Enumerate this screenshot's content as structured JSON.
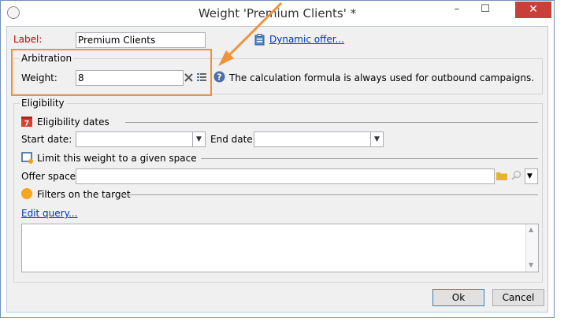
{
  "window": {
    "title": "Weight 'Premium Clients' *",
    "minimize": "–",
    "maximize": "☐",
    "close": "✕"
  },
  "label_field": {
    "label": "Label:",
    "value": "Premium Clients"
  },
  "dynamic_offer": {
    "link": "Dynamic offer..."
  },
  "arbitration": {
    "title": "Arbitration",
    "weight_label": "Weight:",
    "weight_value": "8",
    "info": "The calculation formula is always used for outbound campaigns."
  },
  "eligibility": {
    "title": "Eligibility",
    "dates_section": "Eligibility dates",
    "start_label": "Start date:",
    "end_label": "End date:",
    "limit_section": "Limit this weight to a given space",
    "offer_space_label": "Offer space:",
    "filters_section": "Filters on the target",
    "edit_query": "Edit query..."
  },
  "buttons": {
    "ok": "Ok",
    "cancel": "Cancel"
  },
  "colors": {
    "highlight": "#f0923b",
    "required_label": "#cc0000",
    "link": "#0033cc"
  }
}
